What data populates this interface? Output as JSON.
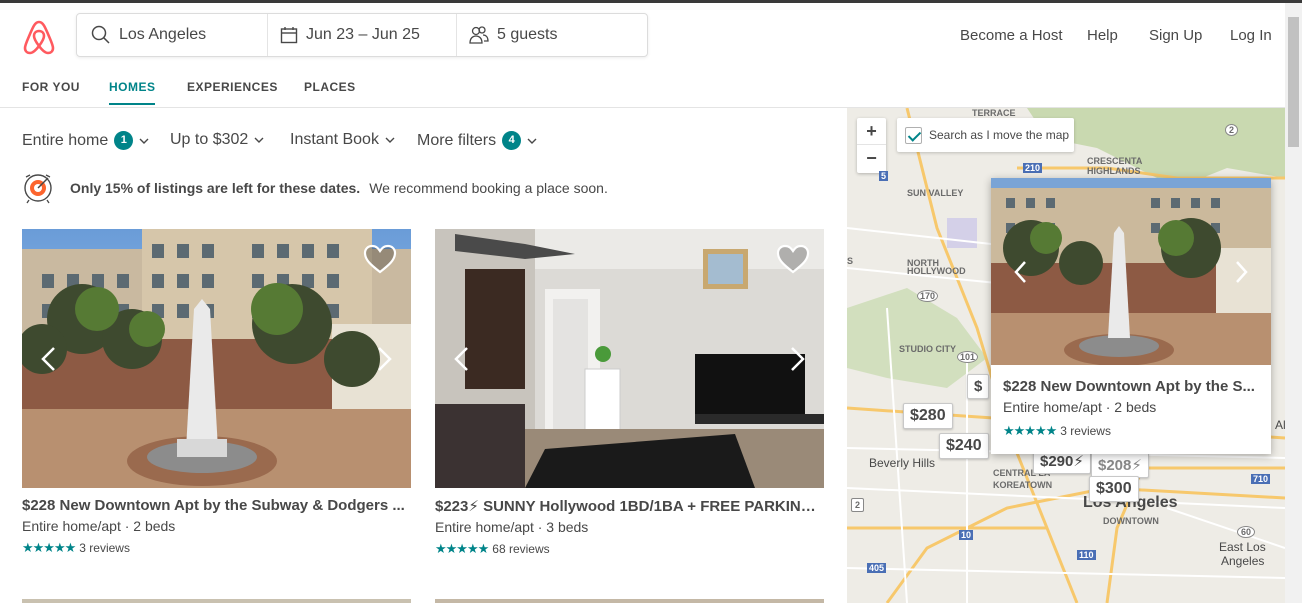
{
  "header": {
    "search": {
      "location": "Los Angeles",
      "dates": "Jun 23 – Jun 25",
      "guests": "5 guests"
    },
    "nav": {
      "become_host": "Become a Host",
      "help": "Help",
      "sign_up": "Sign Up",
      "log_in": "Log In"
    }
  },
  "tabs": [
    {
      "label": "FOR YOU"
    },
    {
      "label": "HOMES"
    },
    {
      "label": "EXPERIENCES"
    },
    {
      "label": "PLACES"
    }
  ],
  "filters": {
    "entire_home": {
      "label": "Entire home",
      "count": "1"
    },
    "price": {
      "label": "Up to $302"
    },
    "instant_book": {
      "label": "Instant Book"
    },
    "more_filters": {
      "label": "More filters",
      "count": "4"
    }
  },
  "notice": {
    "bold": "Only 15% of listings are left for these dates.",
    "text": "We recommend booking a place soon."
  },
  "listings": [
    {
      "title": "$228 New Downtown Apt by the Subway & Dodgers ...",
      "sub": "Entire home/apt · 2 beds",
      "stars": "★★★★★",
      "reviews": "3 reviews"
    },
    {
      "title": "$223⚡ SUNNY Hollywood 1BD/1BA + FREE PARKING...",
      "sub": "Entire home/apt · 3 beds",
      "stars": "★★★★★",
      "reviews": "68 reviews"
    }
  ],
  "map": {
    "search_toggle": "Search as I move the map",
    "zoom_in": "+",
    "zoom_out": "−",
    "labels": {
      "terrace": "TERRACE",
      "crescenta": "CRESCENTA",
      "highlands": "HIGHLANDS",
      "sun_valley": "SUN VALLEY",
      "north": "NORTH",
      "hollywood": "HOLLYWOOD",
      "studio_city": "STUDIO CITY",
      "beverly_hills": "Beverly Hills",
      "central_la": "CENTRAL LA",
      "koreatown": "KOREATOWN",
      "los_angeles": "Los Angeles",
      "downtown": "DOWNTOWN",
      "east_la_1": "East Los",
      "east_la_2": "Angeles",
      "al": "Al",
      "s": "S"
    },
    "road_numbers": [
      "2",
      "210",
      "5",
      "170",
      "101",
      "405",
      "10",
      "110",
      "60",
      "710",
      "2"
    ],
    "pins": [
      "$280",
      "$240",
      "$290⚡",
      "$208⚡",
      "$300",
      "$"
    ],
    "popup": {
      "title": "$228 New Downtown Apt by the S...",
      "sub": "Entire home/apt · 2 beds",
      "stars": "★★★★★",
      "reviews": "3 reviews"
    }
  },
  "colors": {
    "brand": "#FF5A5F",
    "accent": "#008489",
    "text": "#484848"
  }
}
